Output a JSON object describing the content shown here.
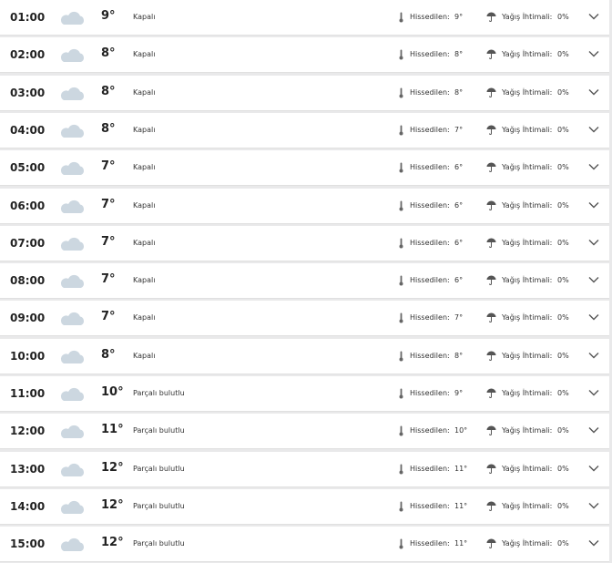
{
  "labels": {
    "feels_like": "Hissedilen:",
    "precip_chance": "Yağış İhtimali:"
  },
  "icons": {
    "condition": "cloud-icon",
    "feels": "thermometer-icon",
    "precip": "umbrella-icon",
    "expand": "chevron-down-icon"
  },
  "colors": {
    "row_bg": "#ffffff",
    "page_bg": "#e9e9ea",
    "cloud": "#ccd7e0"
  },
  "hours": [
    {
      "time": "01:00",
      "temp": "9°",
      "condition": "Kapalı",
      "feels": "9°",
      "precip": "0%"
    },
    {
      "time": "02:00",
      "temp": "8°",
      "condition": "Kapalı",
      "feels": "8°",
      "precip": "0%"
    },
    {
      "time": "03:00",
      "temp": "8°",
      "condition": "Kapalı",
      "feels": "8°",
      "precip": "0%"
    },
    {
      "time": "04:00",
      "temp": "8°",
      "condition": "Kapalı",
      "feels": "7°",
      "precip": "0%"
    },
    {
      "time": "05:00",
      "temp": "7°",
      "condition": "Kapalı",
      "feels": "6°",
      "precip": "0%"
    },
    {
      "time": "06:00",
      "temp": "7°",
      "condition": "Kapalı",
      "feels": "6°",
      "precip": "0%"
    },
    {
      "time": "07:00",
      "temp": "7°",
      "condition": "Kapalı",
      "feels": "6°",
      "precip": "0%"
    },
    {
      "time": "08:00",
      "temp": "7°",
      "condition": "Kapalı",
      "feels": "6°",
      "precip": "0%"
    },
    {
      "time": "09:00",
      "temp": "7°",
      "condition": "Kapalı",
      "feels": "7°",
      "precip": "0%"
    },
    {
      "time": "10:00",
      "temp": "8°",
      "condition": "Kapalı",
      "feels": "8°",
      "precip": "0%"
    },
    {
      "time": "11:00",
      "temp": "10°",
      "condition": "Parçalı bulutlu",
      "feels": "9°",
      "precip": "0%"
    },
    {
      "time": "12:00",
      "temp": "11°",
      "condition": "Parçalı bulutlu",
      "feels": "10°",
      "precip": "0%"
    },
    {
      "time": "13:00",
      "temp": "12°",
      "condition": "Parçalı bulutlu",
      "feels": "11°",
      "precip": "0%"
    },
    {
      "time": "14:00",
      "temp": "12°",
      "condition": "Parçalı bulutlu",
      "feels": "11°",
      "precip": "0%"
    },
    {
      "time": "15:00",
      "temp": "12°",
      "condition": "Parçalı bulutlu",
      "feels": "11°",
      "precip": "0%"
    }
  ]
}
